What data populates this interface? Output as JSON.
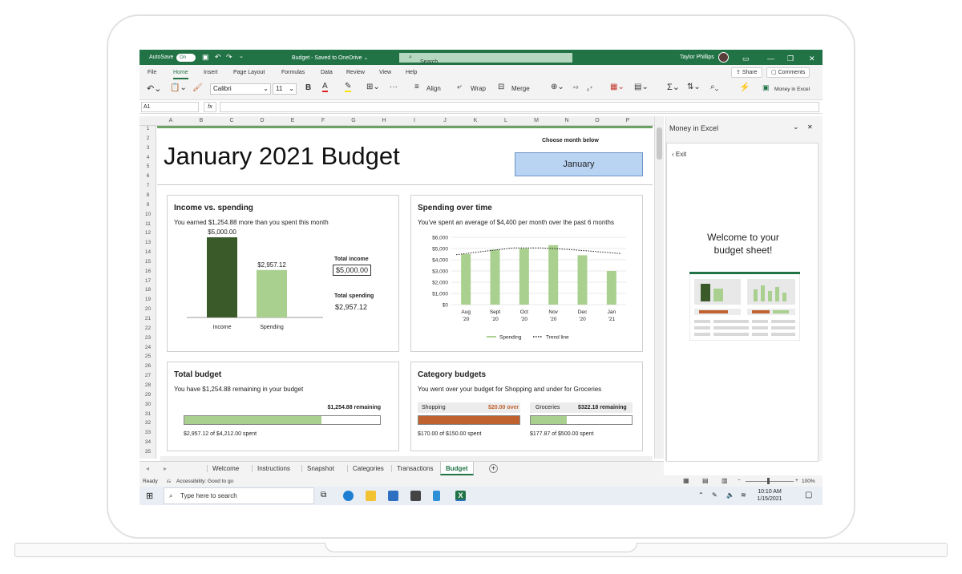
{
  "window": {
    "autosave_label": "AutoSave",
    "autosave_state": "On",
    "doc_title": "Budget - Saved to OneDrive ⌄",
    "search_placeholder": "Search",
    "user_name": "Taylor Phillips"
  },
  "ribbon_tabs": [
    "File",
    "Home",
    "Insert",
    "Page Layout",
    "Formulas",
    "Data",
    "Review",
    "View",
    "Help"
  ],
  "share_label": "Share",
  "comments_label": "Comments",
  "ribbon": {
    "font_name": "Calibri",
    "font_size": "11",
    "bold": "B",
    "font_color_letter": "A",
    "align_label": "Align",
    "wrap_label": "Wrap",
    "merge_label": "Merge",
    "money_label": "Money in Excel"
  },
  "formula": {
    "name_box": "A1",
    "fx": "fx",
    "content": ""
  },
  "columns": [
    "A",
    "B",
    "C",
    "D",
    "E",
    "F",
    "G",
    "H",
    "I",
    "J",
    "K",
    "L",
    "M",
    "N",
    "O",
    "P"
  ],
  "rows": [
    "1",
    "2",
    "3",
    "4",
    "5",
    "6",
    "7",
    "8",
    "9",
    "10",
    "11",
    "12",
    "13",
    "14",
    "15",
    "16",
    "17",
    "18",
    "19",
    "20",
    "21",
    "22",
    "23",
    "24",
    "25",
    "26",
    "27",
    "28",
    "29",
    "30",
    "31",
    "32",
    "33",
    "34",
    "35"
  ],
  "sheet": {
    "title": "January 2021 Budget",
    "choose_label": "Choose month below",
    "month": "January"
  },
  "income_card": {
    "title": "Income vs. spending",
    "subtitle": "You earned $1,254.88 more than you spent this month",
    "total_income_label": "Total income",
    "total_income": "$5,000.00",
    "total_spending_label": "Total spending",
    "total_spending": "$2,957.12"
  },
  "spending_card": {
    "title": "Spending over time",
    "subtitle": "You've spent an average of $4,400 per month over the past 6 months",
    "legend_spending": "Spending",
    "legend_trend": "Trend line"
  },
  "total_budget_card": {
    "title": "Total budget",
    "subtitle": "You have $1,254.88 remaining in your budget",
    "remaining": "$1,254.88 remaining",
    "spent": "$2,957.12 of $4,212.00 spent",
    "fraction_spent": 0.702,
    "bar_color": "#a9d08e"
  },
  "category_card": {
    "title": "Category budgets",
    "subtitle": "You went over your budget for Shopping and under for Groceries",
    "shopping_label": "Shopping",
    "shopping_status": "$20.00 over",
    "shopping_spent": "$170.00 of $150.00 spent",
    "shopping_fraction": 1.0,
    "shopping_color": "#c0622f",
    "groceries_label": "Groceries",
    "groceries_status": "$322.18 remaining",
    "groceries_spent": "$177.87 of $500.00 spent",
    "groceries_fraction": 0.356,
    "groceries_color": "#a9d08e"
  },
  "chart_data": [
    {
      "type": "bar",
      "title": "Income vs. spending",
      "categories": [
        "Income",
        "Spending"
      ],
      "values": [
        5000.0,
        2957.12
      ],
      "data_labels": [
        "$5,000.00",
        "$2,957.12"
      ],
      "colors": [
        "#3b5a2a",
        "#a9d08e"
      ],
      "ylim": [
        0,
        6000
      ],
      "grid": false
    },
    {
      "type": "bar",
      "title": "Spending over time",
      "categories": [
        "Aug '20",
        "Sept '20",
        "Oct '20",
        "Nov '20",
        "Dec '20",
        "Jan '21"
      ],
      "category_lines": [
        [
          "Aug",
          "'20"
        ],
        [
          "Sept",
          "'20"
        ],
        [
          "Oct",
          "'20"
        ],
        [
          "Nov",
          "'20"
        ],
        [
          "Dec",
          "'20"
        ],
        [
          "Jan",
          "'21"
        ]
      ],
      "series": [
        {
          "name": "Spending",
          "type": "bar",
          "values": [
            4500,
            4900,
            5000,
            5300,
            4400,
            3000
          ],
          "color": "#a9d08e"
        },
        {
          "name": "Trend line",
          "type": "line",
          "style": "dotted",
          "values": [
            4450,
            4750,
            5050,
            5050,
            4900,
            4550
          ],
          "color": "#222222"
        }
      ],
      "yticks": [
        "$6,000",
        "$5,000",
        "$4,000",
        "$3,000",
        "$2,000",
        "$1,000",
        "$0"
      ],
      "ylim": [
        0,
        6000
      ],
      "grid": true,
      "legend": "bottom"
    }
  ],
  "pane": {
    "title": "Money in Excel",
    "exit_label": "Exit",
    "welcome_line1": "Welcome to your",
    "welcome_line2": "budget sheet!"
  },
  "sheet_tabs": [
    "Welcome",
    "Instructions",
    "Snapshot",
    "Categories",
    "Transactions",
    "Budget"
  ],
  "active_tab": "Budget",
  "status": {
    "ready": "Ready",
    "accessibility": "Accessibility: Good to go",
    "zoom": "100%"
  },
  "taskbar": {
    "search_placeholder": "Type here to search",
    "time": "10:10 AM",
    "date": "1/15/2021"
  }
}
